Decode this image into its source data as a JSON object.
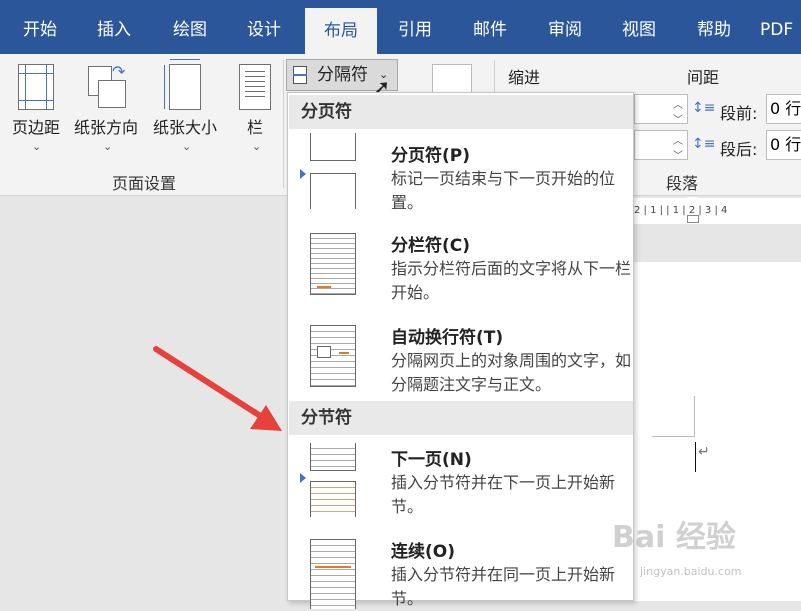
{
  "tabs": [
    "开始",
    "插入",
    "绘图",
    "设计",
    "布局",
    "引用",
    "邮件",
    "审阅",
    "视图",
    "帮助",
    "PDF"
  ],
  "active_tab": "布局",
  "ribbon": {
    "margins": "页边距",
    "orientation": "纸张方向",
    "size": "纸张大小",
    "columns": "栏",
    "breaks": "分隔符",
    "page_setup_label": "页面设置",
    "indent_label": "缩进",
    "spacing_label": "间距",
    "before_label": "段前:",
    "after_label": "段后:",
    "before_value": "0 行",
    "after_value": "0 行",
    "paragraph_label": "段落"
  },
  "ruler_text": "2 | 1 |  | 1 | 2 | 3 | 4",
  "menu": {
    "page_breaks_header": "分页符",
    "section_breaks_header": "分节符",
    "items": [
      {
        "title": "分页符(P)",
        "desc": "标记一页结束与下一页开始的位置。"
      },
      {
        "title": "分栏符(C)",
        "desc": "指示分栏符后面的文字将从下一栏开始。"
      },
      {
        "title": "自动换行符(T)",
        "desc": "分隔网页上的对象周围的文字，如分隔题注文字与正文。"
      },
      {
        "title": "下一页(N)",
        "desc": "插入分节符并在下一页上开始新节。"
      },
      {
        "title": "连续(O)",
        "desc": "插入分节符并在同一页上开始新节。"
      }
    ]
  },
  "watermark": "Bai 经验",
  "watermark_url": "jingyan.baidu.com",
  "colors": {
    "tab_bar": "#2b579a",
    "arrow": "#e8413c",
    "marker": "#4a72c4"
  }
}
